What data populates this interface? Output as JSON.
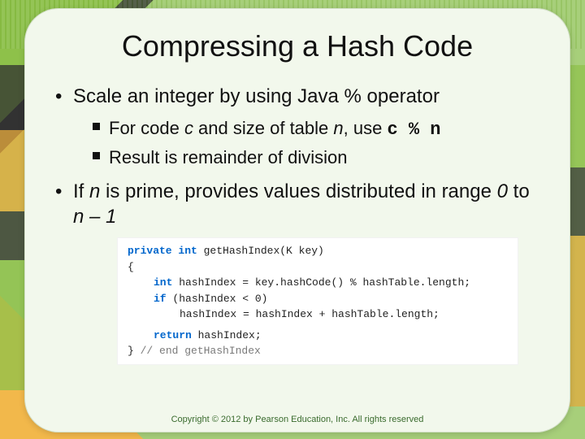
{
  "title": "Compressing a Hash Code",
  "bullets": {
    "b1": {
      "text": "Scale an integer by using Java % operator",
      "sub": {
        "s1_pre": "For code ",
        "s1_c": "c",
        "s1_mid": " and size of table ",
        "s1_n": "n",
        "s1_post": ", use ",
        "s1_code": "c % n",
        "s2": "Result is remainder of division"
      }
    },
    "b2_pre": "If ",
    "b2_n": "n",
    "b2_mid": " is prime, provides values distributed in range ",
    "b2_zero": "0",
    "b2_to": " to ",
    "b2_nm1_n": "n",
    "b2_nm1_rest": " – 1"
  },
  "code": {
    "kw_private": "private",
    "kw_int": "int",
    "fn_sig": " getHashIndex(K key)",
    "brace_open": "{",
    "l1a": " hashIndex = key.hashCode() % hashTable.length;",
    "kw_if": "if",
    "l2a": " (hashIndex < 0)",
    "l3": "hashIndex = hashIndex + hashTable.length;",
    "kw_return": "return",
    "l4": " hashIndex;",
    "brace_close": "} ",
    "cmt": "// end getHashIndex"
  },
  "footer": "Copyright © 2012 by Pearson Education, Inc. All rights reserved"
}
